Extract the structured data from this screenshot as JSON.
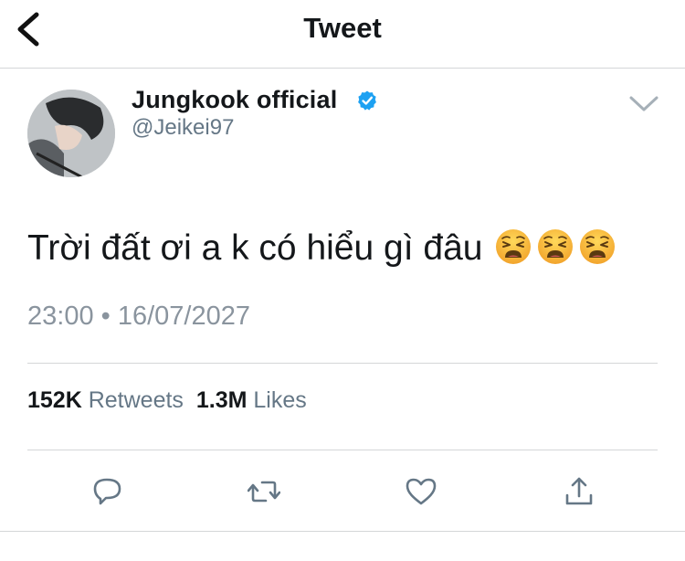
{
  "header": {
    "title": "Tweet",
    "back_icon": "chevron-left-icon"
  },
  "author": {
    "name": "Jungkook  official",
    "handle": "@Jeikei97",
    "verified": true,
    "verified_color": "#1da1f2"
  },
  "tweet": {
    "text": "Trời đất ơi a k có hiểu gì đâu",
    "emoji": [
      "weary-face",
      "weary-face",
      "weary-face"
    ]
  },
  "timestamp": {
    "time": "23:00",
    "separator": "•",
    "date": "16/07/2027"
  },
  "stats": {
    "retweets_count": "152K",
    "retweets_label": "Retweets",
    "likes_count": "1.3M",
    "likes_label": "Likes"
  },
  "actions": [
    "reply-icon",
    "retweet-icon",
    "like-icon",
    "share-icon"
  ],
  "colors": {
    "text": "#14171a",
    "secondary": "#657786",
    "divider": "#d4d6d8",
    "icon": "#657786"
  }
}
